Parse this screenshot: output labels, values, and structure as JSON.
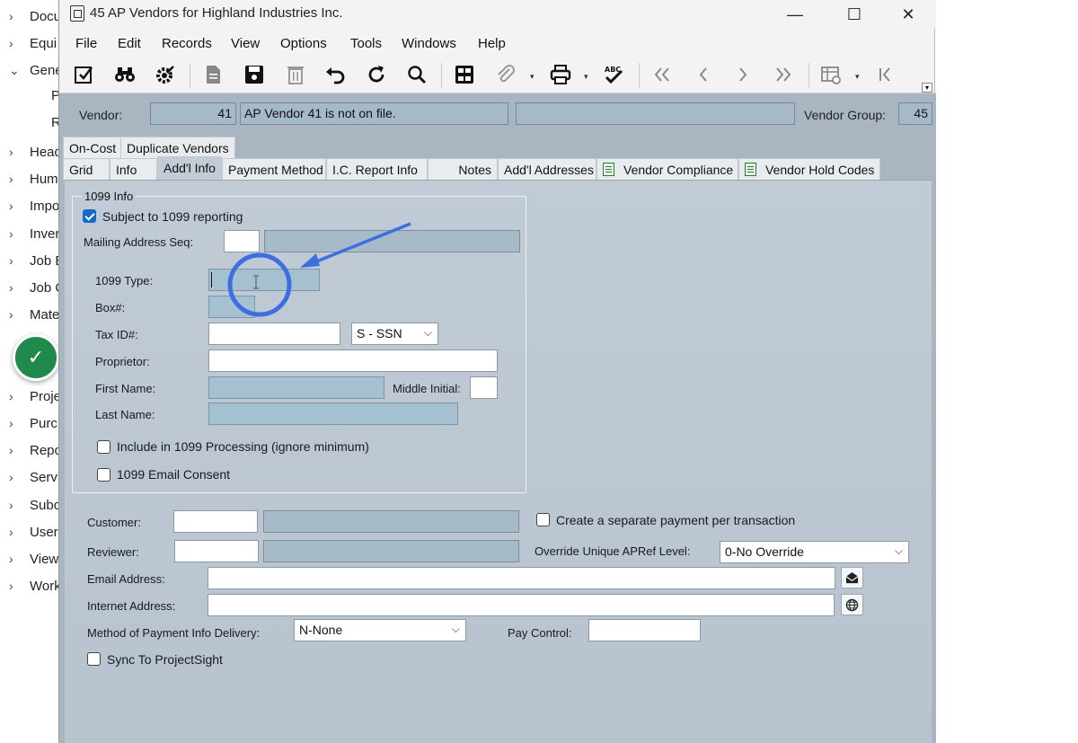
{
  "left_tree": {
    "items": [
      {
        "label": "Docu",
        "chev": ">"
      },
      {
        "label": "Equi",
        "chev": ">"
      },
      {
        "label": "Gene",
        "chev": "v"
      },
      {
        "label": "Head",
        "chev": ">"
      },
      {
        "label": "Hum",
        "chev": ">"
      },
      {
        "label": "Impo",
        "chev": ">"
      },
      {
        "label": "Inver",
        "chev": ">"
      },
      {
        "label": "Job E",
        "chev": ">"
      },
      {
        "label": "Job C",
        "chev": ">"
      },
      {
        "label": "Mate",
        "chev": ">"
      },
      {
        "label": "Proje",
        "chev": ">"
      },
      {
        "label": "Purc",
        "chev": ">"
      },
      {
        "label": "Repo",
        "chev": ">"
      },
      {
        "label": "Servi",
        "chev": ">"
      },
      {
        "label": "Subc",
        "chev": ">"
      },
      {
        "label": "User",
        "chev": ">"
      },
      {
        "label": "View",
        "chev": ">"
      },
      {
        "label": "Work",
        "chev": ">"
      }
    ],
    "subitems": [
      "P",
      "R"
    ],
    "check_badge": "✓"
  },
  "window": {
    "title": "45 AP Vendors for Highland Industries Inc.",
    "controls": {
      "minimize": "—",
      "maximize": "☐",
      "close": "✕"
    }
  },
  "menu": [
    "File",
    "Edit",
    "Records",
    "View",
    "Options",
    "Tools",
    "Windows",
    "Help"
  ],
  "toolbar": {
    "icons": [
      "edit-icon",
      "binoculars-icon",
      "settings-gear-icon",
      "document-icon",
      "save-icon",
      "delete-icon",
      "undo-icon",
      "refresh-icon",
      "search-icon",
      "grid-icon",
      "attach-icon",
      "print-icon",
      "spellcheck-icon",
      "first-record-icon",
      "prev-record-icon",
      "next-record-icon",
      "last-record-icon",
      "table-settings-icon",
      "go-start-icon"
    ],
    "dropdown_caret": "▾"
  },
  "header": {
    "vendor_label": "Vendor:",
    "vendor_value": "41",
    "vendor_desc": "AP Vendor 41 is not on file.",
    "vendor_extra": "",
    "vendor_group_label": "Vendor Group:",
    "vendor_group_value": "45"
  },
  "tabs": {
    "row1": [
      "On-Cost",
      "Duplicate Vendors"
    ],
    "row2": [
      "Grid",
      "Info",
      "Add'l Info",
      "Payment Method",
      "I.C. Report Info",
      "Notes",
      "Add'l Addresses",
      "Vendor Compliance",
      "Vendor Hold Codes"
    ],
    "active": "Add'l Info"
  },
  "info_1099": {
    "legend": "1099 Info",
    "subject_label": "Subject to 1099 reporting",
    "subject_checked": true,
    "mailing_seq_label": "Mailing Address Seq:",
    "mailing_seq_value": "",
    "mailing_seq_desc": "",
    "type_label": "1099 Type:",
    "type_value": "",
    "box_label": "Box#:",
    "box_value": "",
    "taxid_label": "Tax ID#:",
    "taxid_value": "",
    "taxid_type": "S - SSN",
    "proprietor_label": "Proprietor:",
    "proprietor_value": "",
    "first_name_label": "First Name:",
    "first_name_value": "",
    "middle_initial_label": "Middle Initial:",
    "middle_initial_value": "",
    "last_name_label": "Last Name:",
    "last_name_value": "",
    "include_label": "Include in 1099 Processing (ignore minimum)",
    "include_checked": false,
    "email_consent_label": "1099 Email Consent",
    "email_consent_checked": false
  },
  "lower": {
    "customer_label": "Customer:",
    "customer_value": "",
    "customer_desc": "",
    "reviewer_label": "Reviewer:",
    "reviewer_value": "",
    "reviewer_desc": "",
    "separate_payment_label": "Create a separate payment per transaction",
    "separate_payment_checked": false,
    "override_label": "Override Unique APRef Level:",
    "override_value": "0-No Override",
    "email_label": "Email Address:",
    "email_value": "",
    "internet_label": "Internet Address:",
    "internet_value": "",
    "method_label": "Method of Payment Info Delivery:",
    "method_value": "N-None",
    "pay_control_label": "Pay Control:",
    "pay_control_value": "",
    "sync_label": "Sync To ProjectSight",
    "sync_checked": false
  },
  "colors": {
    "content_bg": "#a9b6c1",
    "panel_bg": "#c1cbd6",
    "annotation": "#3d6fe0",
    "badge": "#1f8a4c"
  }
}
